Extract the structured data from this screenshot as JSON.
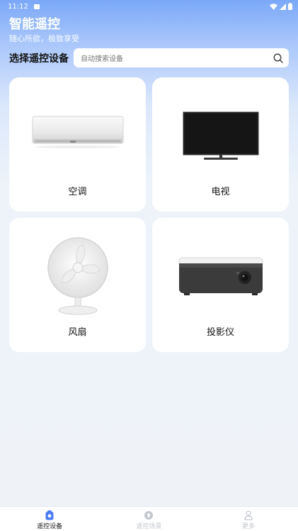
{
  "status_bar": {
    "time": "11:12"
  },
  "header": {
    "title": "智能遥控",
    "subtitle": "随心所欲，极致享受"
  },
  "device_select": {
    "label": "选择遥控设备",
    "search_placeholder": "自动搜索设备"
  },
  "devices": [
    {
      "label": "空调",
      "icon": "air-conditioner"
    },
    {
      "label": "电视",
      "icon": "television"
    },
    {
      "label": "风扇",
      "icon": "electric-fan"
    },
    {
      "label": "投影仪",
      "icon": "projector"
    }
  ],
  "bottom_nav": [
    {
      "label": "遥控设备",
      "icon": "remote-icon",
      "active": true
    },
    {
      "label": "遥控场景",
      "icon": "scene-icon",
      "active": false
    },
    {
      "label": "更多",
      "icon": "person-icon",
      "active": false
    }
  ],
  "colors": {
    "accent": "#4a7cf2",
    "inactive": "#c3c7ce"
  }
}
